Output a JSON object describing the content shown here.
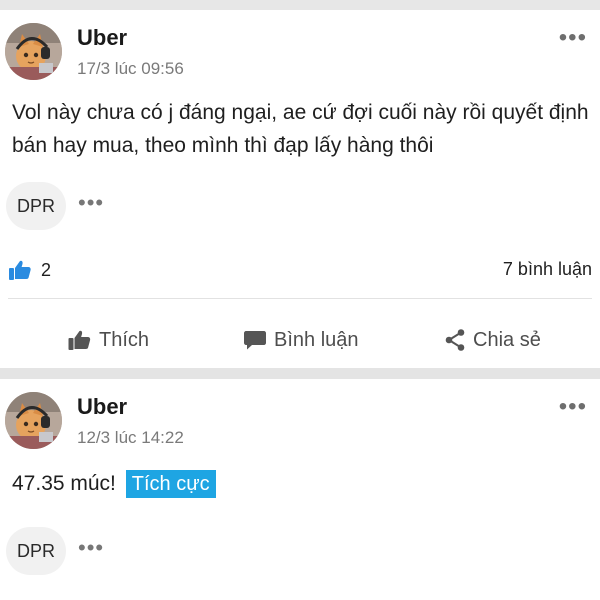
{
  "posts": [
    {
      "author": "Uber",
      "timestamp": "17/3 lúc 09:56",
      "content": "Vol này chưa có j đáng ngại, ae cứ đợi cuối này rồi quyết định bán hay mua, theo mình thì đạp lấy hàng thôi",
      "tag_chip": "DPR",
      "more_glyph": "•••",
      "likes": "2",
      "comments": "7 bình luận",
      "actions": {
        "like": "Thích",
        "comment": "Bình luận",
        "share": "Chia sẻ"
      }
    },
    {
      "author": "Uber",
      "timestamp": "12/3 lúc 14:22",
      "content": "47.35 múc!",
      "highlight_tag": "Tích cực",
      "tag_chip": "DPR",
      "more_glyph": "•••"
    }
  ],
  "colors": {
    "accent": "#1ea5e3",
    "like_icon": "#2a8be0",
    "separator": "#e4e4e4",
    "muted_text": "#7a7a7a"
  },
  "icons": {
    "like": "thumbs-up-icon",
    "comment": "speech-bubble-icon",
    "share": "share-icon",
    "more": "more-dots-icon"
  }
}
